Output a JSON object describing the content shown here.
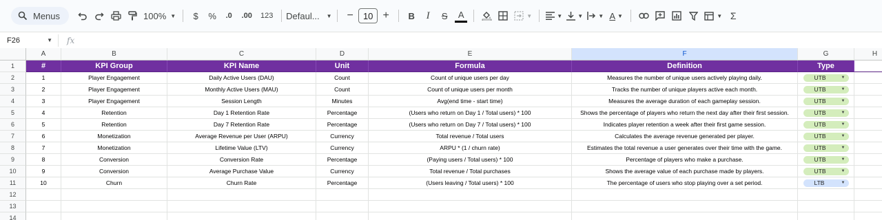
{
  "toolbar": {
    "search_label": "Menus",
    "zoom": "100%",
    "currency": "$",
    "percent": "%",
    "dec_decrease": ".0",
    "dec_increase": ".00",
    "number_format": "123",
    "font": "Defaul...",
    "font_size": "10",
    "minus": "−",
    "plus": "+",
    "bold": "B",
    "italic": "I",
    "strike": "S",
    "textcolor": "A",
    "sum": "Σ"
  },
  "formula_bar": {
    "cell_ref": "F26",
    "fx": "fx",
    "value": ""
  },
  "columns": [
    {
      "letter": "A",
      "selected": false
    },
    {
      "letter": "B",
      "selected": false
    },
    {
      "letter": "C",
      "selected": false
    },
    {
      "letter": "D",
      "selected": false
    },
    {
      "letter": "E",
      "selected": false
    },
    {
      "letter": "F",
      "selected": true
    },
    {
      "letter": "G",
      "selected": false
    },
    {
      "letter": "H",
      "selected": false
    }
  ],
  "row_numbers": [
    "1",
    "2",
    "3",
    "4",
    "5",
    "6",
    "7",
    "8",
    "9",
    "10",
    "11",
    "12",
    "13",
    "14"
  ],
  "header_row": [
    "#",
    "KPI Group",
    "KPI Name",
    "Unit",
    "Formula",
    "Definition",
    "Type"
  ],
  "rows": [
    [
      "1",
      "Player Engagement",
      "Daily Active Users (DAU)",
      "Count",
      "Count of unique users per day",
      "Measures the number of unique users actively playing daily.",
      "UTB"
    ],
    [
      "2",
      "Player Engagement",
      "Monthly Active Users (MAU)",
      "Count",
      "Count of unique users per month",
      "Tracks the number of unique players active each month.",
      "UTB"
    ],
    [
      "3",
      "Player Engagement",
      "Session Length",
      "Minutes",
      "Avg(end time - start time)",
      "Measures the average duration of each gameplay session.",
      "UTB"
    ],
    [
      "4",
      "Retention",
      "Day 1 Retention Rate",
      "Percentage",
      "(Users who return on Day 1 / Total users) * 100",
      "Shows the percentage of players who return the next day after their first session.",
      "UTB"
    ],
    [
      "5",
      "Retention",
      "Day 7 Retention Rate",
      "Percentage",
      "(Users who return on Day 7 / Total users) * 100",
      "Indicates player retention a week after their first game session.",
      "UTB"
    ],
    [
      "6",
      "Monetization",
      "Average Revenue per User (ARPU)",
      "Currency",
      "Total revenue / Total users",
      "Calculates the average revenue generated per player.",
      "UTB"
    ],
    [
      "7",
      "Monetization",
      "Lifetime Value (LTV)",
      "Currency",
      "ARPU * (1 / churn rate)",
      "Estimates the total revenue a user generates over their time with the game.",
      "UTB"
    ],
    [
      "8",
      "Conversion",
      "Conversion Rate",
      "Percentage",
      "(Paying users / Total users) * 100",
      "Percentage of players who make a purchase.",
      "UTB"
    ],
    [
      "9",
      "Conversion",
      "Average Purchase Value",
      "Currency",
      "Total revenue / Total purchases",
      "Shows the average value of each purchase made by players.",
      "UTB"
    ],
    [
      "10",
      "Churn",
      "Churn Rate",
      "Percentage",
      "(Users leaving / Total users) * 100",
      "The percentage of users who stop playing over a set period.",
      "LTB"
    ]
  ],
  "colors": {
    "header_bg": "#7030a0",
    "utb_chip": "#d4edbc",
    "ltb_chip": "#d3e3fd",
    "selected_col": "#d3e3fd"
  }
}
